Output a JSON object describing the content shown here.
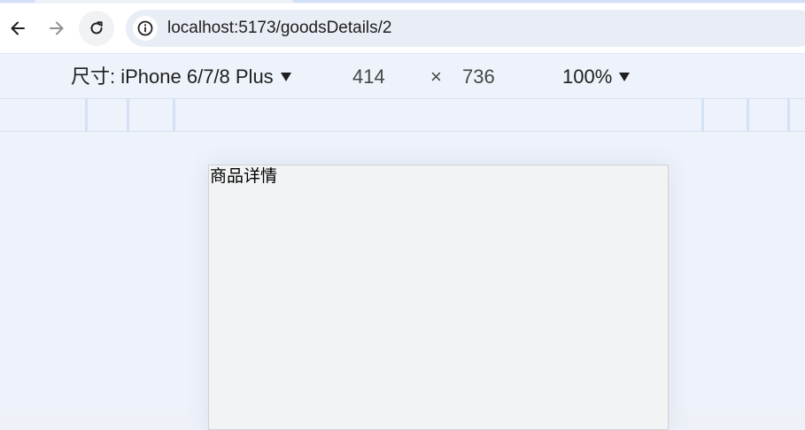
{
  "browser": {
    "url": "localhost:5173/goodsDetails/2",
    "icons": {
      "back": "arrow-left-icon",
      "forward": "arrow-right-icon",
      "reload": "reload-icon",
      "site_info": "info-icon"
    }
  },
  "device_toolbar": {
    "dimensions_label": "尺寸: iPhone 6/7/8 Plus",
    "width": "414",
    "times_symbol": "×",
    "height": "736",
    "zoom": "100%"
  },
  "page": {
    "title": "商品详情"
  },
  "colors": {
    "toolbar_bg": "#ffffff",
    "omnibox_bg": "#e9edf6",
    "devbar_bg": "#edf2fb",
    "viewport_bg": "#eef2fa",
    "device_bg": "#f2f3f5"
  }
}
